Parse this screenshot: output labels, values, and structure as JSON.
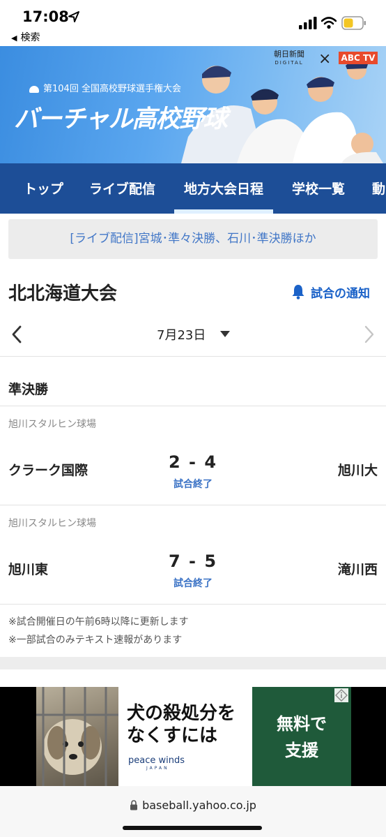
{
  "status_bar": {
    "time": "17:08",
    "back_label": "検索"
  },
  "banner": {
    "subtitle": "第104回 全国高校野球選手権大会",
    "title": "バーチャル高校野球",
    "partner1_name": "朝日新聞",
    "partner1_sub": "DIGITAL",
    "partner2_name": "ABC TV",
    "close_label": "×"
  },
  "nav": {
    "tabs": [
      {
        "label": "トップ"
      },
      {
        "label": "ライブ配信"
      },
      {
        "label": "地方大会日程"
      },
      {
        "label": "学校一覧"
      },
      {
        "label": "動"
      }
    ],
    "active_index": 2
  },
  "notice": "[ライブ配信]宮城･準々決勝、石川･準決勝ほか",
  "tournament": {
    "title": "北北海道大会",
    "notify_label": "試合の通知",
    "date": "7月23日",
    "round": "準決勝"
  },
  "games": [
    {
      "venue": "旭川スタルヒン球場",
      "home": "クラーク国際",
      "score": "2 - 4",
      "away": "旭川大",
      "status": "試合終了"
    },
    {
      "venue": "旭川スタルヒン球場",
      "home": "旭川東",
      "score": "7 - 5",
      "away": "滝川西",
      "status": "試合終了"
    }
  ],
  "footnotes": [
    "※試合開催日の午前6時以降に更新します",
    "※一部試合のみテキスト速報があります"
  ],
  "ad": {
    "headline_line1": "犬の殺処分を",
    "headline_line2": "なくすには",
    "brand": "peace winds",
    "brand_sub": "JAPAN",
    "cta_line1": "無料で",
    "cta_line2": "支援"
  },
  "url_bar": {
    "url": "baseball.yahoo.co.jp"
  },
  "colors": {
    "nav_bg": "#1d4e97",
    "link_blue": "#1b62c8",
    "status_blue": "#3a72c5"
  }
}
